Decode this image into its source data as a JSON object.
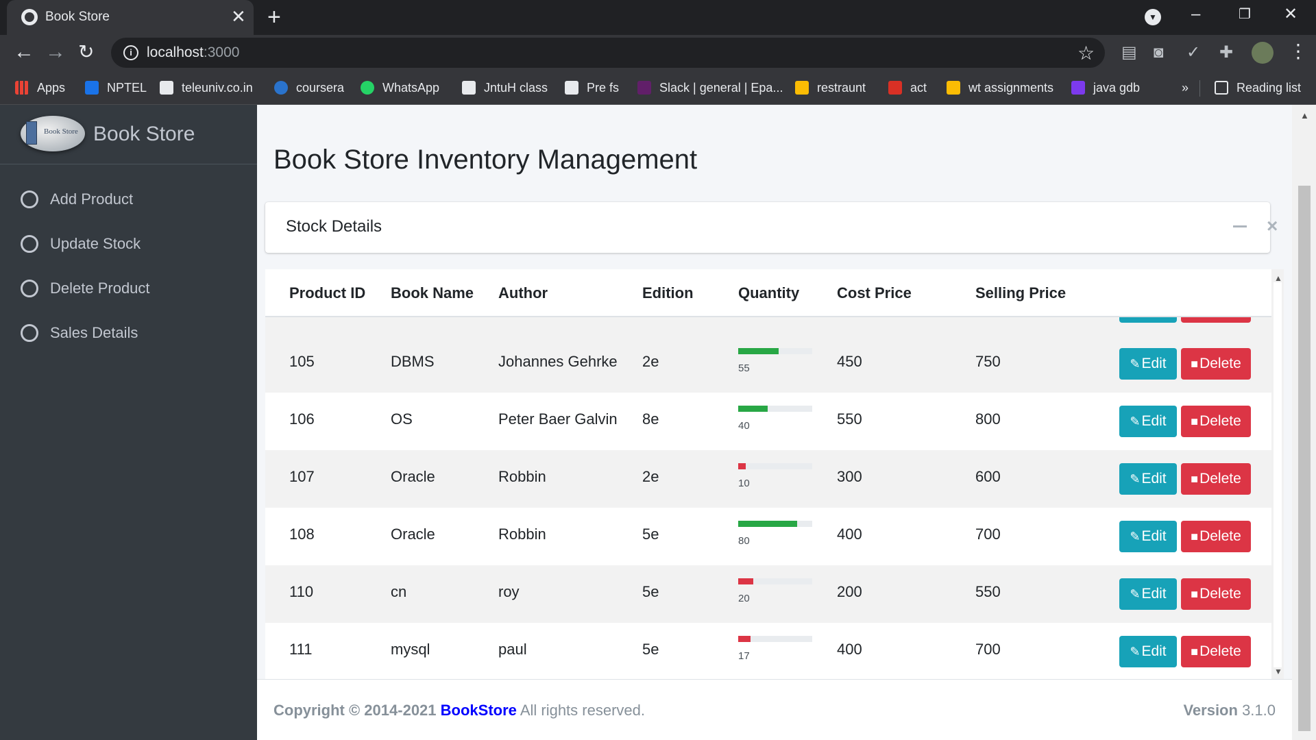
{
  "browser": {
    "tab_title": "Book Store",
    "tab_close": "✕",
    "new_tab": "+",
    "url_host": "localhost",
    "url_port": ":3000",
    "bookmarks": [
      {
        "label": "Apps",
        "color": "#ea4335"
      },
      {
        "label": "NPTEL",
        "color": "#1a73e8"
      },
      {
        "label": "teleuniv.co.in",
        "color": "#e8eaed"
      },
      {
        "label": "coursera",
        "color": "#2a73cc"
      },
      {
        "label": "WhatsApp",
        "color": "#25d366"
      },
      {
        "label": "JntuH class",
        "color": "#e8eaed"
      },
      {
        "label": "Pre fs",
        "color": "#e8eaed"
      },
      {
        "label": "Slack | general | Epa...",
        "color": "#611f69"
      },
      {
        "label": "restraunt",
        "color": "#fbbc04"
      },
      {
        "label": "act",
        "color": "#d93025"
      },
      {
        "label": "wt assignments",
        "color": "#fbbc04"
      },
      {
        "label": "java gdb",
        "color": "#7c3aed"
      }
    ],
    "more_bookmarks": "»",
    "reading_list": "Reading list"
  },
  "sidebar": {
    "brand_text": "Book Store",
    "logo_text": "Book Store",
    "items": [
      {
        "label": "Add Product"
      },
      {
        "label": "Update Stock"
      },
      {
        "label": "Delete Product"
      },
      {
        "label": "Sales Details"
      }
    ]
  },
  "main": {
    "page_title": "Book Store Inventory Management",
    "card_title": "Stock Details",
    "columns": [
      "Product ID",
      "Book Name",
      "Author",
      "Edition",
      "Quantity",
      "Cost Price",
      "Selling Price"
    ],
    "edit_label": "Edit",
    "delete_label": "Delete",
    "rows": [
      {
        "id": "105",
        "name": "DBMS",
        "author": "Johannes Gehrke",
        "edition": "2e",
        "quantity": "55",
        "qty_pct": 55,
        "cost": "450",
        "selling": "750",
        "bar_color": "#28a745"
      },
      {
        "id": "106",
        "name": "OS",
        "author": "Peter Baer Galvin",
        "edition": "8e",
        "quantity": "40",
        "qty_pct": 40,
        "cost": "550",
        "selling": "800",
        "bar_color": "#28a745"
      },
      {
        "id": "107",
        "name": "Oracle",
        "author": "Robbin",
        "edition": "2e",
        "quantity": "10",
        "qty_pct": 10,
        "cost": "300",
        "selling": "600",
        "bar_color": "#dc3545"
      },
      {
        "id": "108",
        "name": "Oracle",
        "author": "Robbin",
        "edition": "5e",
        "quantity": "80",
        "qty_pct": 80,
        "cost": "400",
        "selling": "700",
        "bar_color": "#28a745"
      },
      {
        "id": "110",
        "name": "cn",
        "author": "roy",
        "edition": "5e",
        "quantity": "20",
        "qty_pct": 20,
        "cost": "200",
        "selling": "550",
        "bar_color": "#dc3545"
      },
      {
        "id": "111",
        "name": "mysql",
        "author": "paul",
        "edition": "5e",
        "quantity": "17",
        "qty_pct": 17,
        "cost": "400",
        "selling": "700",
        "bar_color": "#dc3545"
      }
    ]
  },
  "footer": {
    "copyright": "Copyright © 2014-2021",
    "brand": "BookStore",
    "rights": "All rights reserved.",
    "version_label": "Version",
    "version_value": "3.1.0"
  },
  "colors": {
    "sidebar_bg": "#343a40",
    "edit_btn": "#17a2b8",
    "delete_btn": "#dc3545",
    "qty_high": "#28a745",
    "qty_low": "#dc3545"
  }
}
